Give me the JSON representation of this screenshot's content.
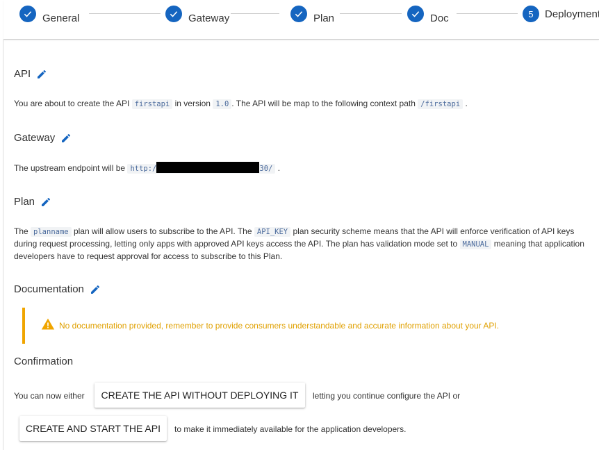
{
  "stepper": {
    "steps": [
      {
        "label": "General",
        "state": "done",
        "icon": "check-icon"
      },
      {
        "label": "Gateway",
        "state": "done",
        "icon": "check-icon"
      },
      {
        "label": "Plan",
        "state": "done",
        "icon": "check-icon"
      },
      {
        "label": "Doc",
        "state": "done",
        "icon": "check-icon"
      },
      {
        "label": "Deployment",
        "state": "active",
        "number": "5"
      }
    ],
    "accent": "#1565c0"
  },
  "sections": {
    "api": {
      "title": "API",
      "text_1": "You are about to create the API",
      "api_name": "firstapi",
      "text_2": "in version",
      "version": "1.0",
      "text_3": ". The API will be map to the following context path",
      "context_path": "/firstapi",
      "text_4": "."
    },
    "gateway": {
      "title": "Gateway",
      "text_1": "The upstream endpoint will be",
      "endpoint_start": "http:/",
      "endpoint_end": "30/",
      "text_2": "."
    },
    "plan": {
      "title": "Plan",
      "text_1": "The",
      "plan_name": "planname",
      "text_2": "plan will allow users to subscribe to the API. The",
      "security": "API_KEY",
      "text_3": "plan security scheme means that the API will enforce verification of API keys during request processing, letting only apps with approved API keys access the API. The plan has validation mode set to",
      "validation": "MANUAL",
      "text_4": "meaning that application developers have to request approval for access to subscribe to this Plan."
    },
    "documentation": {
      "title": "Documentation",
      "warning": "No documentation provided, remember to provide consumers understandable and accurate information about your API.",
      "warning_color": "#e0a000"
    },
    "confirmation": {
      "title": "Confirmation",
      "text_1": "You can now either",
      "button_create": "CREATE THE API WITHOUT DEPLOYING IT",
      "text_2": "letting you continue configure the API or",
      "button_start": "CREATE AND START THE API",
      "text_3": "to make it immediately available for the application developers."
    }
  },
  "icons": {
    "edit": "pencil-icon",
    "warning": "warning-triangle-icon",
    "edit_color": "#1565c0"
  }
}
